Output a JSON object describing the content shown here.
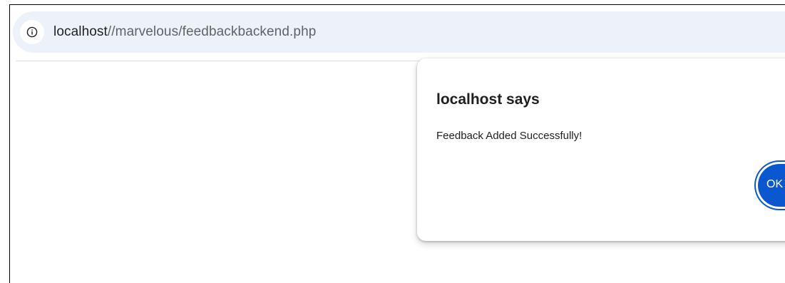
{
  "browser": {
    "address_bar": {
      "icon": "info-icon",
      "url_host": "localhost",
      "url_path": "//marvelous/feedbackbackend.php"
    }
  },
  "dialog": {
    "title": "localhost says",
    "message": "Feedback Added Successfully!",
    "ok_label": "OK"
  },
  "colors": {
    "address_bar_bg": "#edf2fa",
    "button_blue": "#0b57d0",
    "text": "#1f1f1f"
  }
}
